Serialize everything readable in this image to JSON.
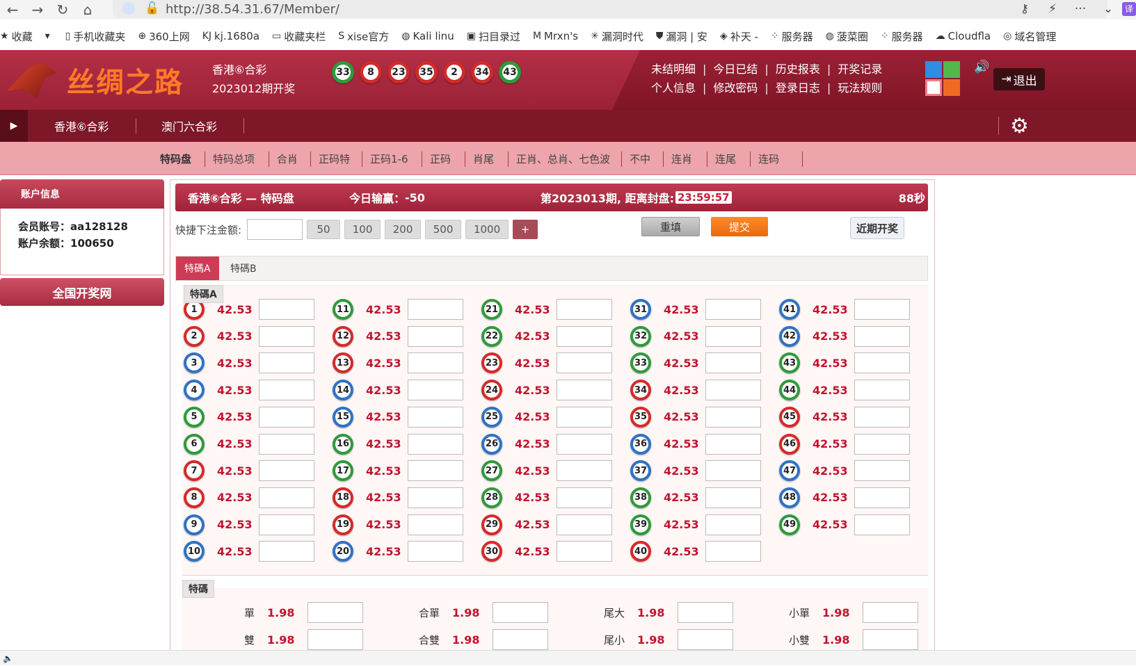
{
  "browser": {
    "url": "http://38.54.31.67/Member/",
    "ext_label": "译",
    "bookmarks": [
      {
        "icon": "★",
        "label": "收藏"
      },
      {
        "icon": "▾",
        "label": ""
      },
      {
        "icon": "▯",
        "label": "手机收藏夹"
      },
      {
        "icon": "⊕",
        "label": "360上网"
      },
      {
        "icon": "KJ",
        "label": "kj.1680a"
      },
      {
        "icon": "▭",
        "label": "收藏夹栏"
      },
      {
        "icon": "S",
        "label": "xise官方"
      },
      {
        "icon": "◍",
        "label": "Kali linu"
      },
      {
        "icon": "▣",
        "label": "扫目录过"
      },
      {
        "icon": "M",
        "label": "Mrxn's"
      },
      {
        "icon": "✳",
        "label": "漏洞时代"
      },
      {
        "icon": "⛊",
        "label": "漏洞 | 安"
      },
      {
        "icon": "◈",
        "label": "补天 -"
      },
      {
        "icon": "⁘",
        "label": "服务器"
      },
      {
        "icon": "◍",
        "label": "菠菜圈"
      },
      {
        "icon": "⁘",
        "label": "服务器"
      },
      {
        "icon": "☁",
        "label": "Cloudfla"
      },
      {
        "icon": "◎",
        "label": "域名管理"
      }
    ]
  },
  "header": {
    "logo_text": "丝绸之路",
    "lottery_name": "香港⑥合彩",
    "draw_period": "2023012期开奖",
    "draw_balls": [
      {
        "n": "33",
        "c": "g"
      },
      {
        "n": "8",
        "c": "r"
      },
      {
        "n": "23",
        "c": "r"
      },
      {
        "n": "35",
        "c": "r"
      },
      {
        "n": "2",
        "c": "r"
      },
      {
        "n": "34",
        "c": "r"
      },
      {
        "n": "43",
        "c": "g"
      }
    ],
    "links_row1": [
      "未结明细",
      "今日已结",
      "历史报表",
      "开奖记录"
    ],
    "links_row2": [
      "个人信息",
      "修改密码",
      "登录日志",
      "玩法规则"
    ],
    "logout_label": "退出",
    "colors": {
      "blue": "#2e8fe0",
      "green": "#52b84a",
      "pink": "#f07f86",
      "orange": "#f06a24"
    }
  },
  "nav1": {
    "tabs": [
      "香港⑥合彩",
      "澳门六合彩"
    ]
  },
  "nav2": {
    "items": [
      "特码盘",
      "特码总项",
      "合肖",
      "正码特",
      "正码1-6",
      "正码",
      "肖尾",
      "正肖、总肖、七色波",
      "不中",
      "连肖",
      "连尾",
      "连码"
    ]
  },
  "sidebar": {
    "title": "账户信息",
    "account_label": "会员账号：",
    "account_value": "aa128128",
    "balance_label": "账户余额：",
    "balance_value": "100650",
    "draw_site_btn": "全国开奖网"
  },
  "main": {
    "title": "香港⑥合彩 — 特码盘",
    "today_label": "今日输赢：",
    "today_value": "-50",
    "period_text": "第2023013期, 距离封盘:",
    "countdown": "23:59:57",
    "refresh_secs": "88秒",
    "quick_label": "快捷下注金额:",
    "quick_amounts": [
      "50",
      "100",
      "200",
      "500",
      "1000",
      "+"
    ],
    "reset_label": "重填",
    "submit_label": "提交",
    "recent_label": "近期开奖",
    "tabs": [
      "特碼A",
      "特碼B"
    ],
    "section_a_label": "特碼A",
    "odds": "42.53",
    "section_b_label": "特碼",
    "tema_rows": [
      [
        {
          "label": "單",
          "odds": "1.98"
        },
        {
          "label": "合單",
          "odds": "1.98"
        },
        {
          "label": "尾大",
          "odds": "1.98"
        },
        {
          "label": "小單",
          "odds": "1.98"
        }
      ],
      [
        {
          "label": "雙",
          "odds": "1.98"
        },
        {
          "label": "合雙",
          "odds": "1.98"
        },
        {
          "label": "尾小",
          "odds": "1.98"
        },
        {
          "label": "小雙",
          "odds": "1.98"
        }
      ]
    ]
  },
  "ball_colors": {
    "r": "#d42a2a",
    "b": "#2f72c4",
    "g": "#2e9a3b"
  },
  "ball_color_map": {
    "1": "r",
    "2": "r",
    "3": "b",
    "4": "b",
    "5": "g",
    "6": "g",
    "7": "r",
    "8": "r",
    "9": "b",
    "10": "b",
    "11": "g",
    "12": "r",
    "13": "r",
    "14": "b",
    "15": "b",
    "16": "g",
    "17": "g",
    "18": "r",
    "19": "r",
    "20": "b",
    "21": "g",
    "22": "g",
    "23": "r",
    "24": "r",
    "25": "b",
    "26": "b",
    "27": "g",
    "28": "g",
    "29": "r",
    "30": "r",
    "31": "b",
    "32": "g",
    "33": "g",
    "34": "r",
    "35": "r",
    "36": "b",
    "37": "b",
    "38": "g",
    "39": "g",
    "40": "r",
    "41": "b",
    "42": "b",
    "43": "g",
    "44": "g",
    "45": "r",
    "46": "r",
    "47": "b",
    "48": "b",
    "49": "g"
  }
}
